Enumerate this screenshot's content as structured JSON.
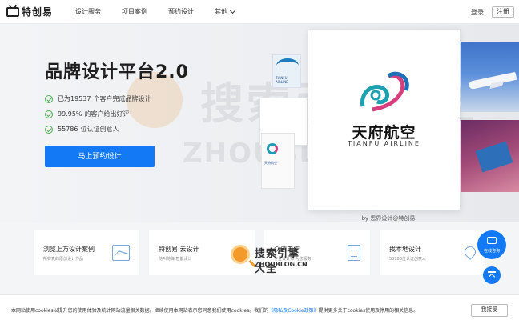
{
  "header": {
    "logo": "特创易",
    "nav": [
      "设计服务",
      "项目案例",
      "预约设计",
      "其他"
    ],
    "login": "登录",
    "register": "注册"
  },
  "hero": {
    "title": "品牌设计平台2.0",
    "bullets": [
      {
        "value": "已为19537",
        "text": "个客户完成品牌设计"
      },
      {
        "value": "99.95%",
        "text": "的客户给出好评"
      },
      {
        "value": "55786",
        "text": "位认证创意人"
      }
    ],
    "cta": "马上预约设计"
  },
  "showcase": {
    "brand_cn": "天府航空",
    "brand_en": "TIANFU AIRLINE",
    "mock_labels": [
      "TIANFU AIRLINE",
      "TIANFU AIRLINE",
      "天府航空"
    ],
    "credit": "by 恩界设计@特创易",
    "dots_count": 5,
    "active_dot": 0
  },
  "watermark": {
    "top_text": "搜索引擎大全",
    "bottom_text": "ZHOUBLOG.CN",
    "center_text": "搜索引擎大全",
    "center_domain": "ZHOUBLOG.CN"
  },
  "cards": [
    {
      "title": "浏览上万设计案例",
      "sub": "所有真的原创设计作品",
      "icon": "image-icon"
    },
    {
      "title": "特创易·云设计",
      "sub": "随叫随弹 智能设计"
    },
    {
      "title": "众创工作",
      "sub": "专业设计师 为您服务"
    },
    {
      "title": "找本地设计",
      "sub": "55786位认证创意人",
      "icon": "location-icon"
    }
  ],
  "float": {
    "chat_label": "在线咨询"
  },
  "cookie": {
    "text_before": "本网站使用cookies以提升您的使用体验及统计网站流量相关数据。继续使用本网站表示您同意我们使用cookies。我们的",
    "link": "《隐私及Cookie政策》",
    "text_after": "提供更多关于cookies使用及停用的相关信息。",
    "accept": "我接受"
  }
}
